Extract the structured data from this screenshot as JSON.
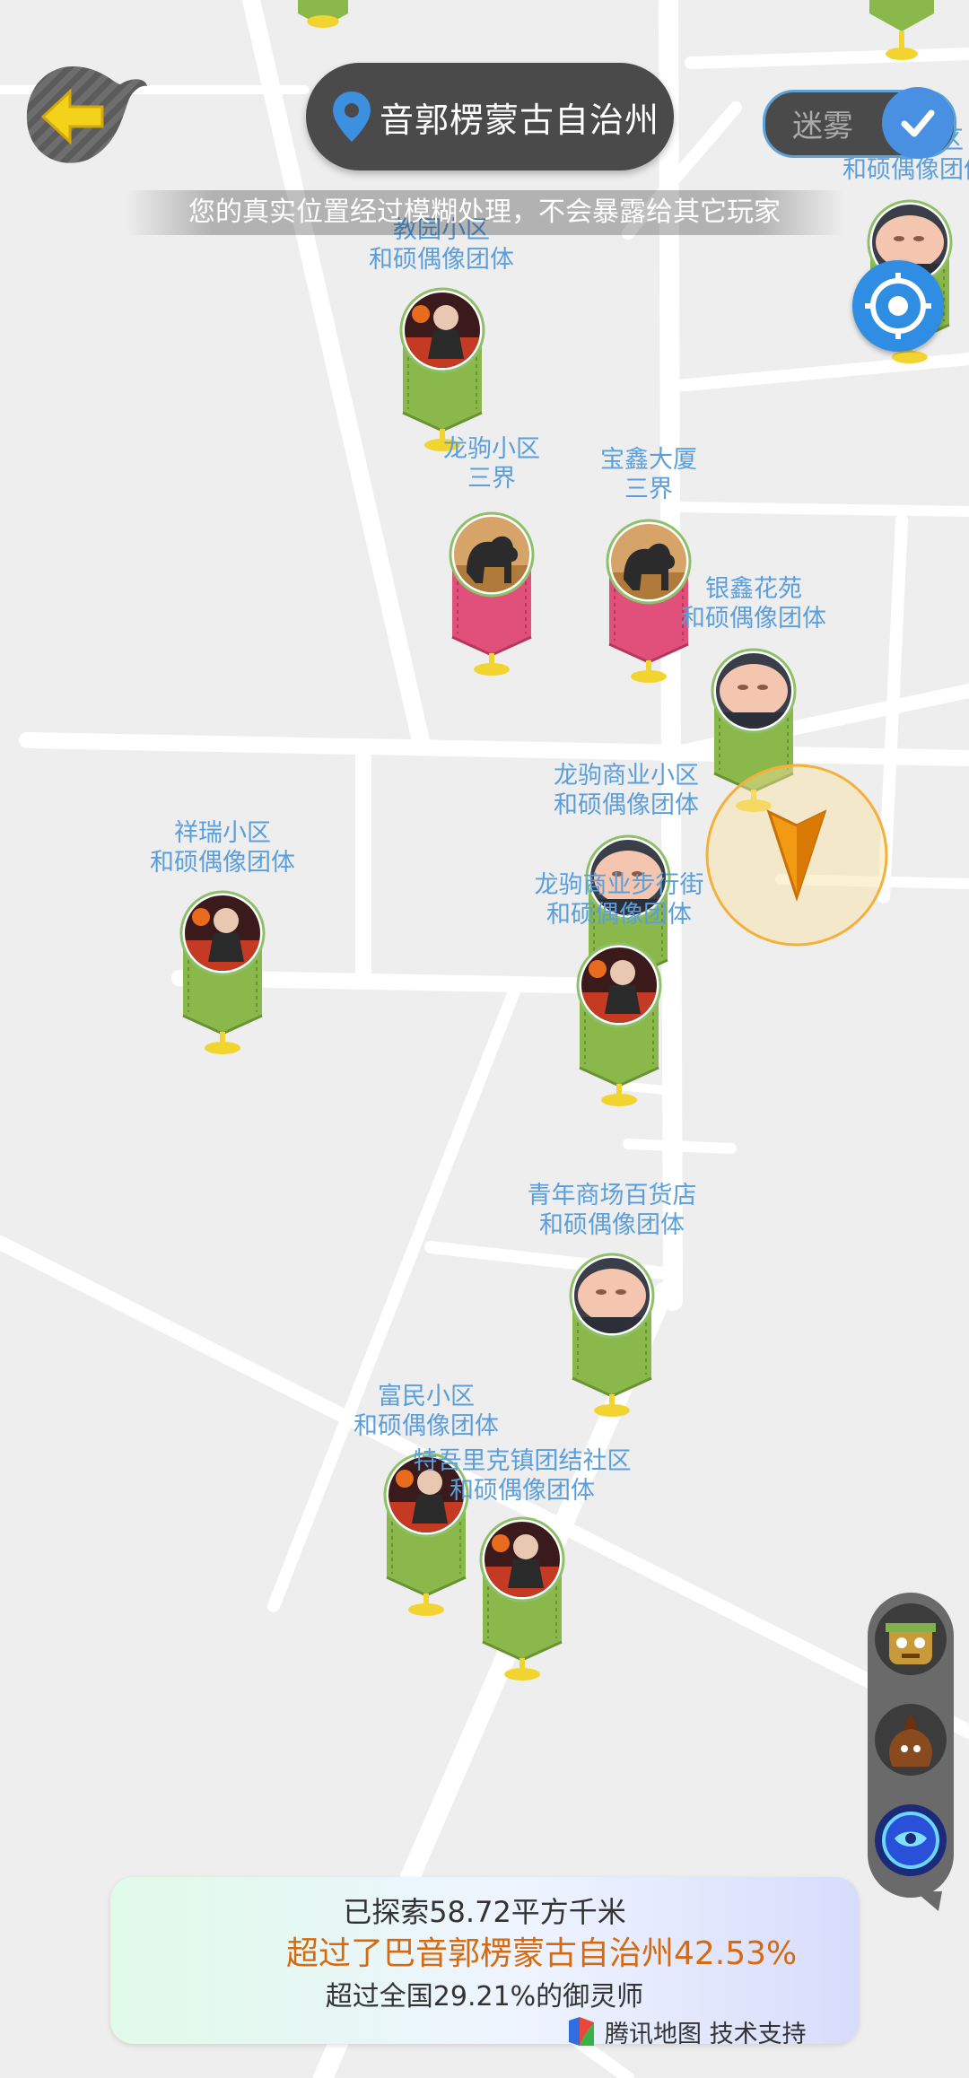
{
  "header": {
    "location_name": "音郭楞蒙古自治州",
    "privacy_notice": "您的真实位置经过模糊处理，不会暴露给其它玩家",
    "fog_toggle_label": "迷雾"
  },
  "markers": [
    {
      "place": "教园小区",
      "group": "和硕偶像团体",
      "ribbon": "green",
      "avatar": "warrior"
    },
    {
      "place": "龙驹小区",
      "group": "三界",
      "ribbon": "pink",
      "avatar": "dog"
    },
    {
      "place": "宝鑫大厦",
      "group": "三界",
      "ribbon": "pink",
      "avatar": "dog"
    },
    {
      "place": "银鑫花苑",
      "group": "和硕偶像团体",
      "ribbon": "green",
      "avatar": "baby"
    },
    {
      "place": "红灯小区",
      "group": "和硕偶像团体",
      "ribbon": "green",
      "avatar": "baby"
    },
    {
      "place": "龙驹商业小区",
      "group": "和硕偶像团体",
      "ribbon": "green",
      "avatar": "baby"
    },
    {
      "place": "龙驹商业步行街",
      "group": "和硕偶像团体",
      "ribbon": "green",
      "avatar": "warrior"
    },
    {
      "place": "祥瑞小区",
      "group": "和硕偶像团体",
      "ribbon": "green",
      "avatar": "warrior"
    },
    {
      "place": "青年商场百货店",
      "group": "和硕偶像团体",
      "ribbon": "green",
      "avatar": "baby"
    },
    {
      "place": "富民小区",
      "group": "和硕偶像团体",
      "ribbon": "green",
      "avatar": "warrior"
    },
    {
      "place": "特吾里克镇团结社区",
      "group": "和硕偶像团体",
      "ribbon": "green",
      "avatar": "warrior"
    }
  ],
  "avatars": [
    "robot-spirit-icon",
    "bag-spirit-icon",
    "blue-mask-spirit-icon"
  ],
  "stats": {
    "explored": "已探索58.72平方千米",
    "region_rank": "超过了巴音郭楞蒙古自治州42.53%",
    "national_rank": "超过全国29.21%的御灵师"
  },
  "attribution": "腾讯地图 技术支持",
  "colors": {
    "ribbon_green": "#8bb84a",
    "ribbon_pink": "#e0507a",
    "label_blue": "#5a9fdc",
    "accent_orange": "#d56a10",
    "locate_blue": "#2f8de4"
  }
}
